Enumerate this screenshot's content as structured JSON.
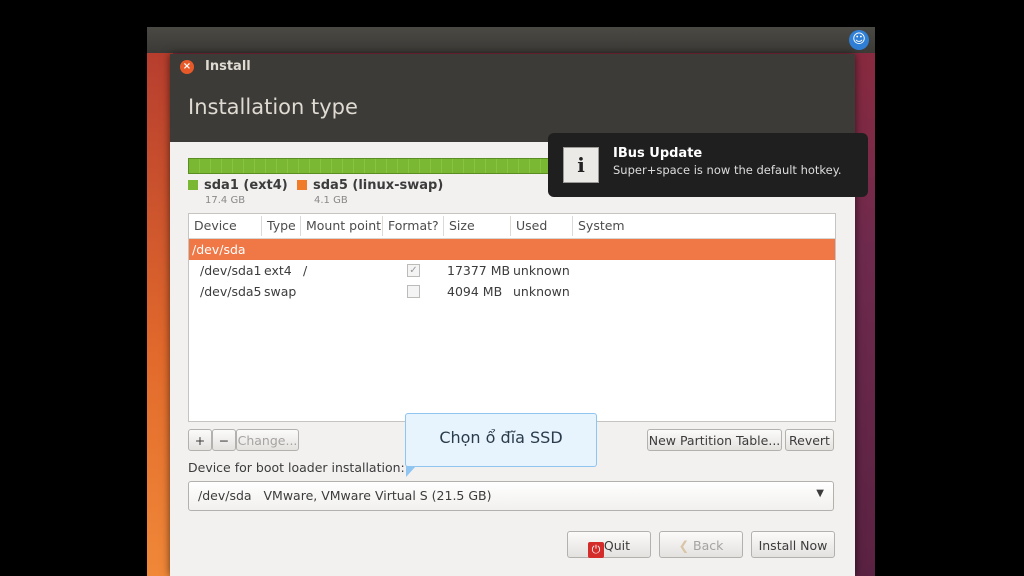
{
  "window": {
    "title": "Install",
    "heading": "Installation type"
  },
  "legend": [
    {
      "name": "sda1 (ext4)",
      "size": "17.4 GB",
      "color": "#7ab833"
    },
    {
      "name": "sda5 (linux-swap)",
      "size": "4.1 GB",
      "color": "#f07c2a"
    }
  ],
  "table": {
    "columns": [
      "Device",
      "Type",
      "Mount point",
      "Format?",
      "Size",
      "Used",
      "System"
    ],
    "disk": "/dev/sda",
    "rows": [
      {
        "device": "/dev/sda1",
        "type": "ext4",
        "mount": "/",
        "format": true,
        "size": "17377 MB",
        "used": "unknown"
      },
      {
        "device": "/dev/sda5",
        "type": "swap",
        "mount": "",
        "format": false,
        "size": "4094 MB",
        "used": "unknown"
      }
    ]
  },
  "controls": {
    "add": "+",
    "remove": "−",
    "change": "Change...",
    "new_table": "New Partition Table...",
    "revert": "Revert"
  },
  "boot": {
    "label": "Device for boot loader installation:",
    "device": "/dev/sda",
    "description": "VMware, VMware Virtual S (21.5 GB)"
  },
  "buttons": {
    "quit": "Quit",
    "back": "Back",
    "install": "Install Now"
  },
  "callout": "Chọn ổ đĩa SSD",
  "notification": {
    "title": "IBus Update",
    "body": "Super+space is now the default hotkey."
  }
}
